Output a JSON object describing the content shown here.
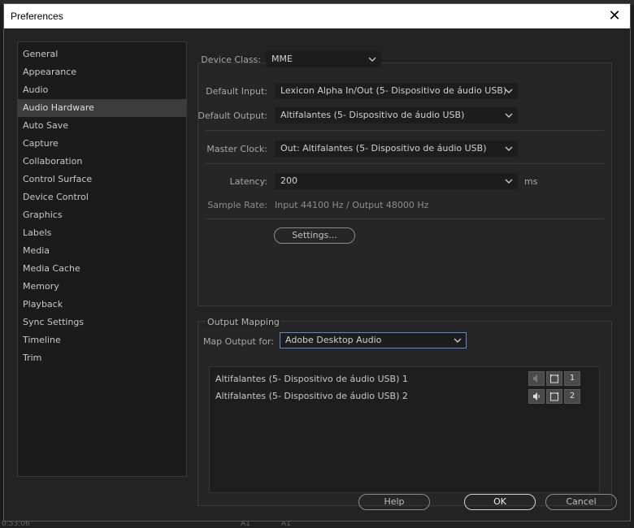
{
  "window": {
    "title": "Preferences",
    "close_glyph": "✕"
  },
  "sidebar": {
    "items": [
      {
        "label": "General"
      },
      {
        "label": "Appearance"
      },
      {
        "label": "Audio"
      },
      {
        "label": "Audio Hardware"
      },
      {
        "label": "Auto Save"
      },
      {
        "label": "Capture"
      },
      {
        "label": "Collaboration"
      },
      {
        "label": "Control Surface"
      },
      {
        "label": "Device Control"
      },
      {
        "label": "Graphics"
      },
      {
        "label": "Labels"
      },
      {
        "label": "Media"
      },
      {
        "label": "Media Cache"
      },
      {
        "label": "Memory"
      },
      {
        "label": "Playback"
      },
      {
        "label": "Sync Settings"
      },
      {
        "label": "Timeline"
      },
      {
        "label": "Trim"
      }
    ],
    "selected": "Audio Hardware"
  },
  "device": {
    "class_label": "Device Class:",
    "class_value": "MME",
    "input_label": "Default Input:",
    "input_value": "Lexicon Alpha In/Out (5- Dispositivo de áudio USB)",
    "output_label": "Default Output:",
    "output_value": "Altifalantes (5- Dispositivo de áudio USB)",
    "clock_label": "Master Clock:",
    "clock_value": "Out: Altifalantes (5- Dispositivo de áudio USB)",
    "latency_label": "Latency:",
    "latency_value": "200",
    "latency_unit": "ms",
    "sample_rate_label": "Sample Rate:",
    "sample_rate_value": "Input 44100 Hz / Output 48000 Hz",
    "settings_button": "Settings..."
  },
  "output_mapping": {
    "legend": "Output Mapping",
    "map_label": "Map Output for:",
    "map_value": "Adobe Desktop Audio",
    "rows": [
      {
        "name": "Altifalantes (5- Dispositivo de áudio USB) 1",
        "channel": "1"
      },
      {
        "name": "Altifalantes (5- Dispositivo de áudio USB) 2",
        "channel": "2"
      }
    ]
  },
  "footer": {
    "help": "Help",
    "ok": "OK",
    "cancel": "Cancel"
  },
  "background": {
    "timecode": "0:53:06",
    "track_a": "A1",
    "track_b": "A1"
  },
  "colors": {
    "focus": "#5a8ad8",
    "selected_item": "#3c3c3c"
  }
}
